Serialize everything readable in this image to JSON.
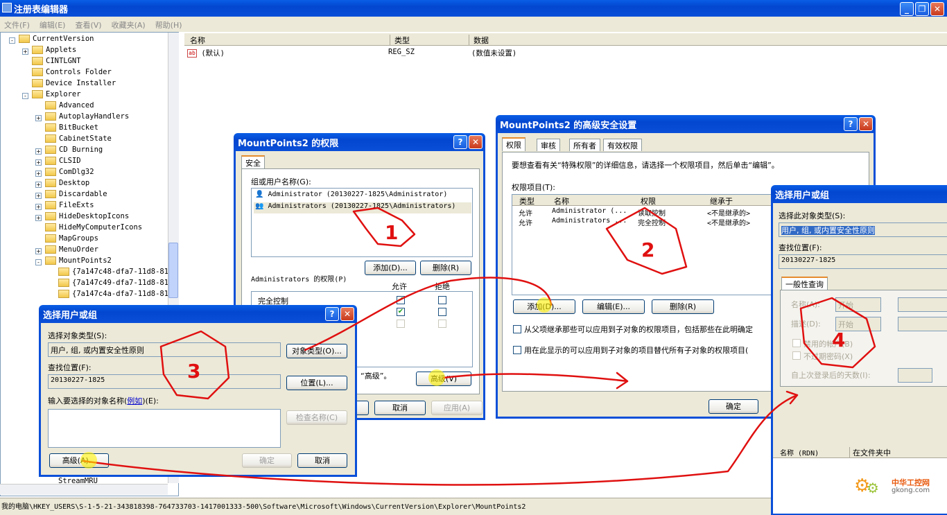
{
  "main": {
    "title": "注册表编辑器",
    "menu": [
      "文件(F)",
      "编辑(E)",
      "查看(V)",
      "收藏夹(A)",
      "帮助(H)"
    ],
    "tree": [
      {
        "label": "CurrentVersion",
        "depth": 0,
        "exp": "-"
      },
      {
        "label": "Applets",
        "depth": 1,
        "exp": "+"
      },
      {
        "label": "CINTLGNT",
        "depth": 1,
        "exp": ""
      },
      {
        "label": "Controls Folder",
        "depth": 1,
        "exp": ""
      },
      {
        "label": "Device Installer",
        "depth": 1,
        "exp": ""
      },
      {
        "label": "Explorer",
        "depth": 1,
        "exp": "-"
      },
      {
        "label": "Advanced",
        "depth": 2,
        "exp": ""
      },
      {
        "label": "AutoplayHandlers",
        "depth": 2,
        "exp": "+"
      },
      {
        "label": "BitBucket",
        "depth": 2,
        "exp": ""
      },
      {
        "label": "CabinetState",
        "depth": 2,
        "exp": ""
      },
      {
        "label": "CD Burning",
        "depth": 2,
        "exp": "+"
      },
      {
        "label": "CLSID",
        "depth": 2,
        "exp": "+"
      },
      {
        "label": "ComDlg32",
        "depth": 2,
        "exp": "+"
      },
      {
        "label": "Desktop",
        "depth": 2,
        "exp": "+"
      },
      {
        "label": "Discardable",
        "depth": 2,
        "exp": "+"
      },
      {
        "label": "FileExts",
        "depth": 2,
        "exp": "+"
      },
      {
        "label": "HideDesktopIcons",
        "depth": 2,
        "exp": "+"
      },
      {
        "label": "HideMyComputerIcons",
        "depth": 2,
        "exp": ""
      },
      {
        "label": "MapGroups",
        "depth": 2,
        "exp": ""
      },
      {
        "label": "MenuOrder",
        "depth": 2,
        "exp": "+"
      },
      {
        "label": "MountPoints2",
        "depth": 2,
        "exp": "-"
      },
      {
        "label": "{7a147c48-dfa7-11d8-811",
        "depth": 3,
        "exp": ""
      },
      {
        "label": "{7a147c49-dfa7-11d8-811",
        "depth": 3,
        "exp": ""
      },
      {
        "label": "{7a147c4a-dfa7-11d8-811",
        "depth": 3,
        "exp": ""
      }
    ],
    "tree_bottom": "StreamMRU",
    "columns": {
      "name": "名称",
      "type": "类型",
      "data": "数据"
    },
    "values": [
      {
        "name": "(默认)",
        "type": "REG_SZ",
        "data": "(数值未设置)"
      }
    ],
    "status": "我的电脑\\HKEY_USERS\\S-1-5-21-343818398-764733703-1417001333-500\\Software\\Microsoft\\Windows\\CurrentVersion\\Explorer\\MountPoints2"
  },
  "perm": {
    "title": "MountPoints2 的权限",
    "tab": "安全",
    "group_label": "组或用户名称(G):",
    "users": [
      "Administrator (20130227-1825\\Administrator)",
      "Administrators (20130227-1825\\Administrators)"
    ],
    "add": "添加(D)...",
    "remove": "删除(R)",
    "perm_label": "Administrators 的权限(P)",
    "allow": "允许",
    "deny": "拒绝",
    "row1": "完全控制",
    "adv_hint": "“高级”。",
    "advanced": "高级(V)",
    "cancel": "取消",
    "apply": "应用(A)"
  },
  "adv": {
    "title": "MountPoints2 的高级安全设置",
    "tabs": [
      "权限",
      "审核",
      "所有者",
      "有效权限"
    ],
    "desc": "要想查看有关“特殊权限”的详细信息，请选择一个权限项目，然后单击“编辑”。",
    "entries_label": "权限项目(T):",
    "cols": [
      "类型",
      "名称",
      "权限",
      "继承于"
    ],
    "rows": [
      [
        "允许",
        "Administrator (...",
        "读取控制",
        "<不是继承的>"
      ],
      [
        "允许",
        "Administrators ...",
        "完全控制",
        "<不是继承的>"
      ]
    ],
    "add": "添加(D)...",
    "edit": "编辑(E)...",
    "remove": "删除(R)",
    "inherit": "从父项继承那些可以应用到子对象的权限项目，包括那些在此明确定",
    "replace": "用在此显示的可以应用到子对象的项目替代所有子对象的权限项目(",
    "ok": "确定"
  },
  "sel1": {
    "title": "选择用户或组",
    "type_label": "选择对象类型(S):",
    "type_value": "用户, 组, 或内置安全性原则",
    "types_btn": "对象类型(O)...",
    "loc_label": "查找位置(F):",
    "loc_value": "20130227-1825",
    "loc_btn": "位置(L)...",
    "name_label": "输入要选择的对象名称(",
    "name_link": "例如",
    "name_label2": ")(E):",
    "check_btn": "检查名称(C)",
    "advanced": "高级(A)...",
    "ok": "确定",
    "cancel": "取消"
  },
  "sel2": {
    "title": "选择用户或组",
    "type_label": "选择此对象类型(S):",
    "type_value": "用户, 组, 或内置安全性原则",
    "loc_label": "查找位置(F):",
    "loc_value": "20130227-1825",
    "tab": "一般性查询",
    "name_label": "名称(A):",
    "name_mode": "开始",
    "desc_label": "描述(D):",
    "desc_mode": "开始",
    "disabled_label": "禁用的帐户(B)",
    "noexpire_label": "不过期密码(X)",
    "days_label": "自上次登录后的天数(I):",
    "col1": "名称 (RDN)",
    "col2": "在文件夹中"
  },
  "watermark": {
    "cn": "中华工控网",
    "en": "gkong.com"
  },
  "annotations": [
    "1",
    "2",
    "3",
    "4"
  ]
}
